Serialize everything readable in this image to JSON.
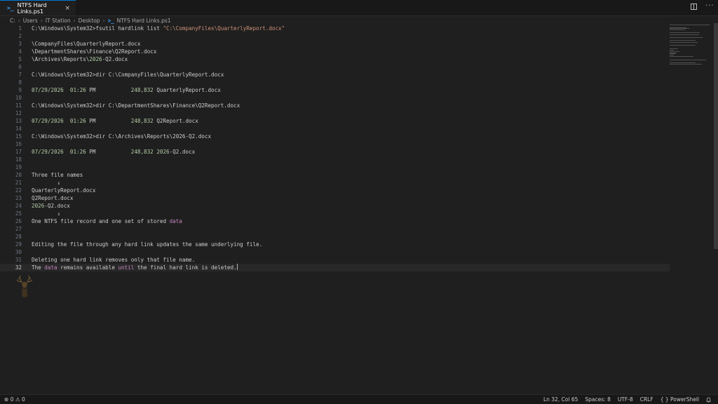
{
  "tab": {
    "title": "NTFS Hard Links.ps1",
    "icon": "powershell-icon",
    "close": "×"
  },
  "breadcrumb": [
    "C:",
    "Users",
    "IT Station",
    "Desktop",
    "NTFS Hard Links.ps1"
  ],
  "editor": {
    "current_line": 32,
    "lines": [
      {
        "n": "1",
        "parts": [
          {
            "t": "C:\\Windows\\System32>fsutil hardlink list ",
            "c": ""
          },
          {
            "t": "\"C:\\CompanyFiles\\QuarterlyReport.docx\"",
            "c": "str"
          }
        ]
      },
      {
        "n": "2",
        "parts": []
      },
      {
        "n": "3",
        "parts": [
          {
            "t": "\\CompanyFiles\\QuarterlyReport.docx",
            "c": ""
          }
        ]
      },
      {
        "n": "4",
        "parts": [
          {
            "t": "\\DepartmentShares\\Finance\\Q2Report.docx",
            "c": ""
          }
        ]
      },
      {
        "n": "5",
        "parts": [
          {
            "t": "\\Archives\\Reports\\",
            "c": ""
          },
          {
            "t": "2026",
            "c": "num"
          },
          {
            "t": "-Q2.docx",
            "c": ""
          }
        ]
      },
      {
        "n": "6",
        "parts": []
      },
      {
        "n": "7",
        "parts": [
          {
            "t": "C:\\Windows\\System32>dir C:\\CompanyFiles\\QuarterlyReport.docx",
            "c": ""
          }
        ]
      },
      {
        "n": "8",
        "parts": []
      },
      {
        "n": "9",
        "parts": [
          {
            "t": "07/29/2026",
            "c": "num"
          },
          {
            "t": "  ",
            "c": ""
          },
          {
            "t": "01:26",
            "c": "num"
          },
          {
            "t": " PM           ",
            "c": ""
          },
          {
            "t": "248,832",
            "c": "num"
          },
          {
            "t": " QuarterlyReport.docx",
            "c": ""
          }
        ]
      },
      {
        "n": "10",
        "parts": []
      },
      {
        "n": "11",
        "parts": [
          {
            "t": "C:\\Windows\\System32>dir C:\\DepartmentShares\\Finance\\Q2Report.docx",
            "c": ""
          }
        ]
      },
      {
        "n": "12",
        "parts": []
      },
      {
        "n": "13",
        "parts": [
          {
            "t": "07/29/2026",
            "c": "num"
          },
          {
            "t": "  ",
            "c": ""
          },
          {
            "t": "01:26",
            "c": "num"
          },
          {
            "t": " PM           ",
            "c": ""
          },
          {
            "t": "248,832",
            "c": "num"
          },
          {
            "t": " Q2Report.docx",
            "c": ""
          }
        ]
      },
      {
        "n": "14",
        "parts": []
      },
      {
        "n": "15",
        "parts": [
          {
            "t": "C:\\Windows\\System32>dir C:\\Archives\\Reports\\2026-Q2.docx",
            "c": ""
          }
        ]
      },
      {
        "n": "16",
        "parts": []
      },
      {
        "n": "17",
        "parts": [
          {
            "t": "07/29/2026",
            "c": "num"
          },
          {
            "t": "  ",
            "c": ""
          },
          {
            "t": "01:26",
            "c": "num"
          },
          {
            "t": " PM           ",
            "c": ""
          },
          {
            "t": "248,832",
            "c": "num"
          },
          {
            "t": " ",
            "c": ""
          },
          {
            "t": "2026",
            "c": "num"
          },
          {
            "t": "-Q2.docx",
            "c": ""
          }
        ]
      },
      {
        "n": "18",
        "parts": []
      },
      {
        "n": "19",
        "parts": []
      },
      {
        "n": "20",
        "parts": [
          {
            "t": "Three file names",
            "c": ""
          }
        ]
      },
      {
        "n": "21",
        "parts": [
          {
            "t": "        ↓",
            "c": ""
          }
        ]
      },
      {
        "n": "22",
        "parts": [
          {
            "t": "QuarterlyReport.docx",
            "c": ""
          }
        ]
      },
      {
        "n": "23",
        "parts": [
          {
            "t": "Q2Report.docx",
            "c": ""
          }
        ]
      },
      {
        "n": "24",
        "parts": [
          {
            "t": "2026",
            "c": "num"
          },
          {
            "t": "-Q2.docx",
            "c": ""
          }
        ]
      },
      {
        "n": "25",
        "parts": [
          {
            "t": "        ↓",
            "c": ""
          }
        ]
      },
      {
        "n": "26",
        "parts": [
          {
            "t": "One NTFS file record and one set of stored ",
            "c": ""
          },
          {
            "t": "data",
            "c": "kw"
          }
        ]
      },
      {
        "n": "27",
        "parts": []
      },
      {
        "n": "28",
        "parts": []
      },
      {
        "n": "29",
        "parts": [
          {
            "t": "Editing the file through any hard link updates the same underlying file.",
            "c": ""
          }
        ]
      },
      {
        "n": "30",
        "parts": []
      },
      {
        "n": "31",
        "parts": [
          {
            "t": "Deleting one hard link removes only that file name.",
            "c": ""
          }
        ]
      },
      {
        "n": "32",
        "parts": [
          {
            "t": "The ",
            "c": ""
          },
          {
            "t": "data",
            "c": "kw"
          },
          {
            "t": " remains available ",
            "c": ""
          },
          {
            "t": "until",
            "c": "kw"
          },
          {
            "t": " the final hard link is deleted.",
            "c": ""
          }
        ]
      }
    ]
  },
  "status": {
    "errors": "0",
    "warnings": "0",
    "position": "Ln 32, Col 65",
    "spaces": "Spaces: 8",
    "encoding": "UTF-8",
    "eol": "CRLF",
    "language": "PowerShell"
  },
  "colors": {
    "accent": "#0078d4",
    "background": "#1f1f1f"
  }
}
